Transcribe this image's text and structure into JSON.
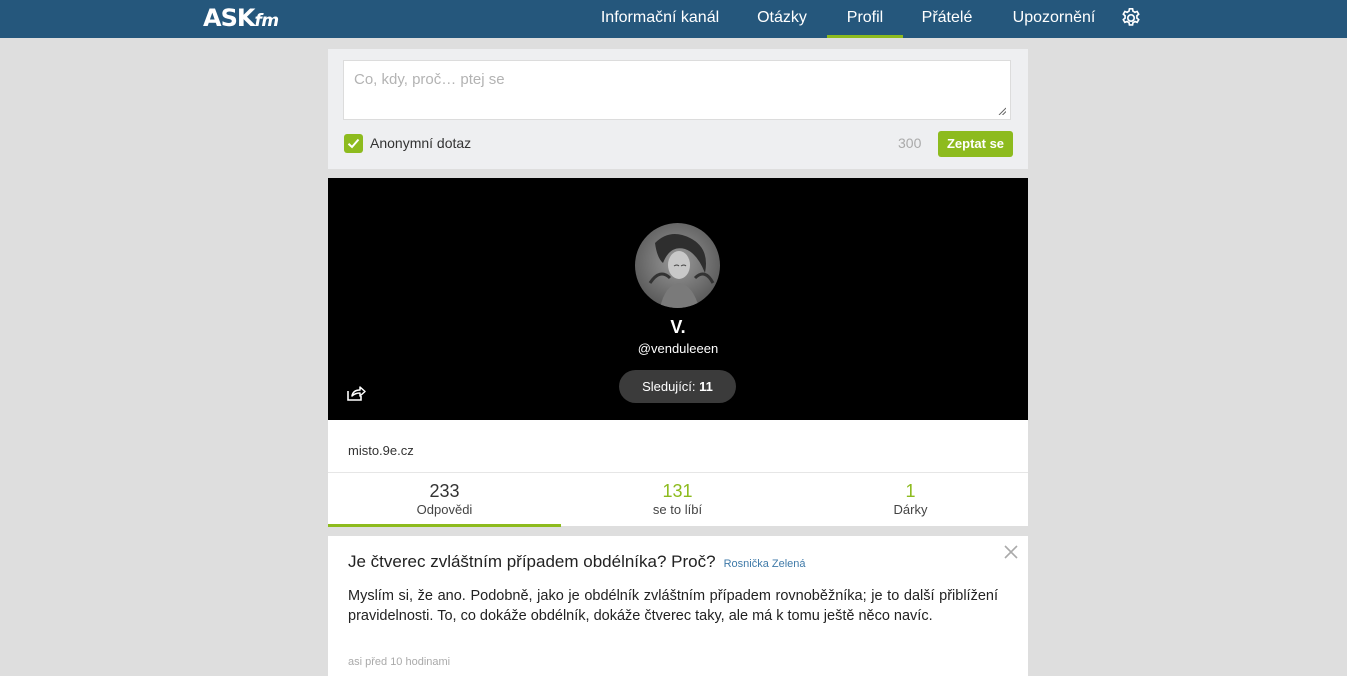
{
  "brand": {
    "logo_main": "ASK",
    "logo_sub": "fm"
  },
  "nav": {
    "items": [
      {
        "label": "Informační kanál"
      },
      {
        "label": "Otázky"
      },
      {
        "label": "Profil"
      },
      {
        "label": "Přátelé"
      },
      {
        "label": "Upozornění"
      }
    ],
    "active_index": 2,
    "settings_icon": "gear-icon"
  },
  "ask": {
    "placeholder": "Co, kdy, proč… ptej se",
    "anonymous_label": "Anonymní dotaz",
    "anonymous_checked": true,
    "char_limit": "300",
    "submit_label": "Zeptat se"
  },
  "profile": {
    "name": "V.",
    "handle": "@venduleeen",
    "followers_label": "Sledující:",
    "followers_count": "11",
    "share_icon": "share-icon"
  },
  "info": {
    "website": "misto.9e.cz"
  },
  "stats": [
    {
      "value": "233",
      "label": "Odpovědi"
    },
    {
      "value": "131",
      "label": "se to líbí"
    },
    {
      "value": "1",
      "label": "Dárky"
    }
  ],
  "answer_card": {
    "question": "Je čtverec zvláštním případem obdélníka? Proč?",
    "asker": "Rosnička Zelená",
    "answer": "Myslím si, že ano. Podobně, jako je obdélník zvláštním případem rovnoběžníka; je to další přiblížení pravidelnosti. To, co dokáže obdélník, dokáže čtverec taky, ale má k tomu ještě něco navíc.",
    "time": "asi před 10 hodinami"
  },
  "colors": {
    "topbar": "#25577c",
    "accent_green": "#8dbb1e",
    "background": "#dedede"
  }
}
